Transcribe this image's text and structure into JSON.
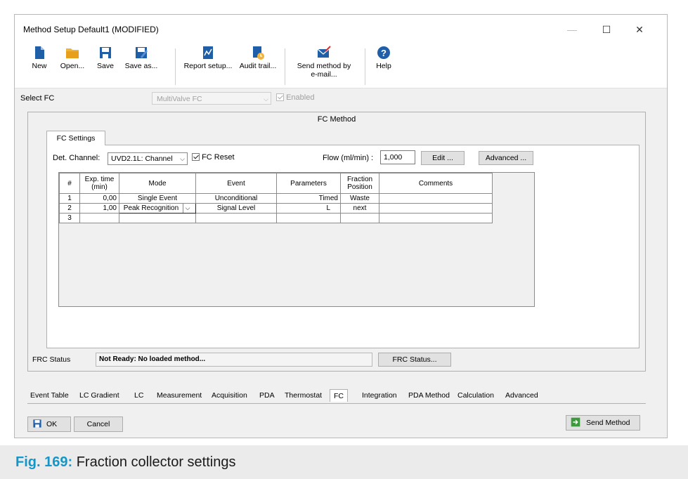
{
  "window": {
    "title": "Method Setup Default1 (MODIFIED)"
  },
  "toolbar": {
    "new": "New",
    "open": "Open...",
    "save": "Save",
    "save_as": "Save as...",
    "report_setup": "Report setup...",
    "audit_trail": "Audit trail...",
    "send_method_line1": "Send method by",
    "send_method_line2": "e-mail...",
    "help": "Help"
  },
  "select_fc": {
    "label": "Select FC",
    "value": "MultiValve FC",
    "enabled_label": "Enabled"
  },
  "fc_method": {
    "legend": "FC Method",
    "tab": "FC Settings",
    "det_channel_label": "Det. Channel:",
    "det_channel_value": "UVD2.1L: Channel",
    "fc_reset_label": "FC Reset",
    "flow_label": "Flow (ml/min) :",
    "flow_value": "1,000",
    "edit_button": "Edit ...",
    "advanced_button": "Advanced ..."
  },
  "table": {
    "headers": {
      "num": "#",
      "exp_time_1": "Exp. time",
      "exp_time_2": "(min)",
      "mode": "Mode",
      "event": "Event",
      "parameters": "Parameters",
      "fraction_1": "Fraction",
      "fraction_2": "Position",
      "comments": "Comments"
    },
    "rows": [
      {
        "num": "1",
        "time": "0,00",
        "mode": "Single Event",
        "event": "Unconditional",
        "params": "Timed",
        "position": "Waste",
        "comments": ""
      },
      {
        "num": "2",
        "time": "1,00",
        "mode": "Peak Recognition",
        "event": "Signal Level",
        "params": "L",
        "position": "next",
        "comments": ""
      },
      {
        "num": "3",
        "time": "",
        "mode": "",
        "event": "",
        "params": "",
        "position": "",
        "comments": ""
      }
    ]
  },
  "frc": {
    "label": "FRC Status",
    "status": "Not Ready: No loaded method...",
    "button": "FRC Status..."
  },
  "bottom_tabs": {
    "event_table": "Event Table",
    "lc_gradient": "LC Gradient",
    "lc": "LC",
    "measurement": "Measurement",
    "acquisition": "Acquisition",
    "pda": "PDA",
    "thermostat": "Thermostat",
    "fc": "FC",
    "integration": "Integration",
    "pda_method": "PDA Method",
    "calculation": "Calculation",
    "advanced": "Advanced"
  },
  "footer": {
    "ok": "OK",
    "cancel": "Cancel",
    "send_method": "Send Method"
  },
  "caption": {
    "fig": "Fig. 169:",
    "text": "Fraction collector settings"
  },
  "colors": {
    "accent": "#1496c8",
    "icon_blue": "#1f5fa8",
    "icon_folder": "#f0b43a",
    "icon_green": "#3c9a3c"
  }
}
